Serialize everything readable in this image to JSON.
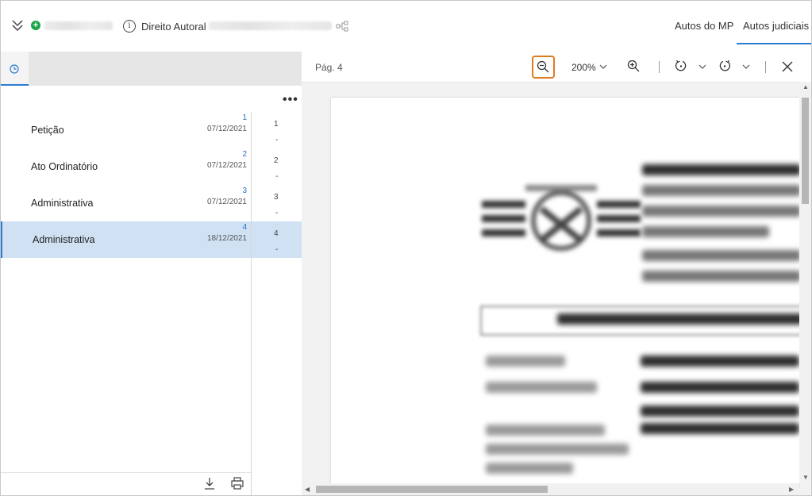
{
  "header": {
    "doc_title": "Direito Autoral",
    "tabs": [
      "Autos do MP",
      "Autos judiciais"
    ],
    "active_tab": "Autos judiciais"
  },
  "sidebar": {
    "documents": [
      {
        "name": "Petição",
        "num": "1",
        "date": "07/12/2021"
      },
      {
        "name": "Ato Ordinatório",
        "num": "2",
        "date": "07/12/2021"
      },
      {
        "name": "Administrativa",
        "num": "3",
        "date": "07/12/2021"
      },
      {
        "name": "Administrativa",
        "num": "4",
        "date": "18/12/2021"
      }
    ],
    "selected_index": 3,
    "page_numbers": [
      "1",
      "2",
      "3",
      "4"
    ],
    "page_dot": "-",
    "more_label": "•••"
  },
  "viewer": {
    "page_label": "Pág. 4",
    "zoom_level": "200%"
  },
  "colors": {
    "accent": "#2b7cd3",
    "selected_row": "#cfe1f3",
    "highlight": "#e07a1f",
    "add_green": "#1ca34a"
  }
}
